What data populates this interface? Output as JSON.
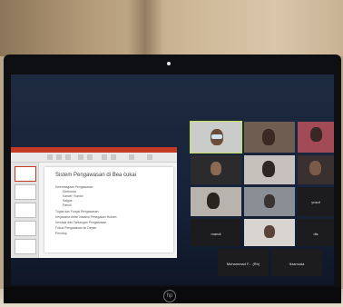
{
  "scene": {
    "slide": {
      "title": "Sistem Pengawasan di Bea cukai",
      "bullets": [
        {
          "text": "Kelembagaan Pengawasan",
          "level": 1
        },
        {
          "text": "Direktorat",
          "level": 2
        },
        {
          "text": "Kanwil / Kantor",
          "level": 2
        },
        {
          "text": "Satgas",
          "level": 2
        },
        {
          "text": "Patroli",
          "level": 2
        },
        {
          "text": "Tugas dan Fungsi Pengawasan",
          "level": 1
        },
        {
          "text": "Kerjasama Antar Instansi Penegakan Hukum",
          "level": 1
        },
        {
          "text": "Kendala dan Tantangan Pengawasan",
          "level": 1
        },
        {
          "text": "Fokus Pengawasan ke Depan",
          "level": 1
        },
        {
          "text": "Penutup",
          "level": 1
        }
      ]
    },
    "participants": [
      {
        "name": "",
        "active": true,
        "bg": "#c9ccc9"
      },
      {
        "name": "",
        "active": false,
        "bg": "#6f5d52"
      },
      {
        "name": "",
        "active": false,
        "bg": "#a24a56"
      },
      {
        "name": "",
        "active": false,
        "bg": "#2b2b2e"
      },
      {
        "name": "",
        "active": false,
        "bg": "#c6c1bc"
      },
      {
        "name": "",
        "active": false,
        "bg": "#3a3030"
      },
      {
        "name": "",
        "active": false,
        "bg": "#b9b3ad"
      },
      {
        "name": "",
        "active": false,
        "bg": "#8a8f96"
      },
      {
        "name": "yusuf",
        "active": false,
        "bg": "#1c1c1e"
      },
      {
        "name": "mandi",
        "active": false,
        "bg": "#1c1c1e"
      },
      {
        "name": "",
        "active": false,
        "bg": "#d8d4cf"
      },
      {
        "name": "dis",
        "active": false,
        "bg": "#1c1c1e"
      },
      {
        "name": "Muhammad F... (Rh)",
        "active": false,
        "bg": "#1c1c1e"
      },
      {
        "name": "Ikramuda",
        "active": false,
        "bg": "#1c1c1e"
      }
    ],
    "laptop_brand": "hp"
  }
}
